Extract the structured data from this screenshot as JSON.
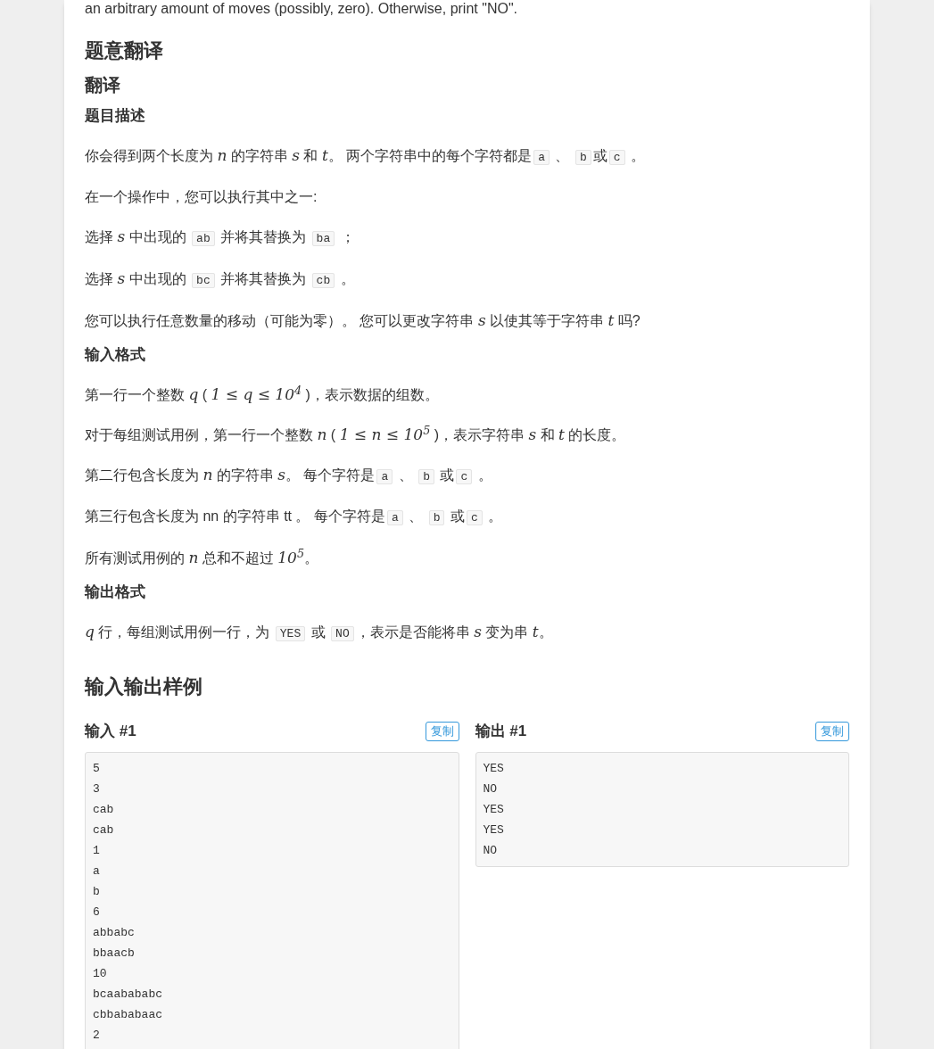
{
  "intro_tail": "an arbitrary amount of moves (possibly, zero). Otherwise, print \"NO\".",
  "translation": {
    "title": "题意翻译",
    "subtitle": "翻译",
    "sections": [
      {
        "heading": "题目描述",
        "paragraphs": [
          [
            {
              "kind": "text",
              "text": "你会得到两个长度为 "
            },
            {
              "kind": "math",
              "text": "n"
            },
            {
              "kind": "text",
              "text": " 的字符串 "
            },
            {
              "kind": "math",
              "text": "s"
            },
            {
              "kind": "text",
              "text": " 和 "
            },
            {
              "kind": "math",
              "text": "t"
            },
            {
              "kind": "text",
              "text": "。 两个字符串中的每个字符都是"
            },
            {
              "kind": "code",
              "text": "a"
            },
            {
              "kind": "text",
              "text": " 、 "
            },
            {
              "kind": "code",
              "text": "b"
            },
            {
              "kind": "text",
              "text": "或"
            },
            {
              "kind": "code",
              "text": "c"
            },
            {
              "kind": "text",
              "text": " 。"
            }
          ],
          [
            {
              "kind": "text",
              "text": "在一个操作中，您可以执行其中之一:"
            }
          ],
          [
            {
              "kind": "text",
              "text": "选择 "
            },
            {
              "kind": "math",
              "text": "s"
            },
            {
              "kind": "text",
              "text": " 中出现的 "
            },
            {
              "kind": "code",
              "text": "ab"
            },
            {
              "kind": "text",
              "text": " 并将其替换为 "
            },
            {
              "kind": "code",
              "text": "ba"
            },
            {
              "kind": "text",
              "text": " ；"
            }
          ],
          [
            {
              "kind": "text",
              "text": "选择 "
            },
            {
              "kind": "math",
              "text": "s"
            },
            {
              "kind": "text",
              "text": " 中出现的 "
            },
            {
              "kind": "code",
              "text": "bc"
            },
            {
              "kind": "text",
              "text": " 并将其替换为 "
            },
            {
              "kind": "code",
              "text": "cb"
            },
            {
              "kind": "text",
              "text": " 。"
            }
          ],
          [
            {
              "kind": "text",
              "text": "您可以执行任意数量的移动（可能为零）。 您可以更改字符串 "
            },
            {
              "kind": "math",
              "text": "s"
            },
            {
              "kind": "text",
              "text": " 以使其等于字符串 "
            },
            {
              "kind": "math",
              "text": "t"
            },
            {
              "kind": "text",
              "text": " 吗?"
            }
          ]
        ]
      },
      {
        "heading": "输入格式",
        "paragraphs": [
          [
            {
              "kind": "text",
              "text": "第一行一个整数 "
            },
            {
              "kind": "math",
              "text": "q"
            },
            {
              "kind": "text",
              "text": " ( "
            },
            {
              "kind": "math",
              "text": "1 ≤ q ≤ 10$^{4}$"
            },
            {
              "kind": "text",
              "text": " )，表示数据的组数。"
            }
          ],
          [
            {
              "kind": "text",
              "text": "对于每组测试用例，第一行一个整数 "
            },
            {
              "kind": "math",
              "text": "n"
            },
            {
              "kind": "text",
              "text": " ( "
            },
            {
              "kind": "math",
              "text": "1 ≤ n ≤ 10$^{5}$"
            },
            {
              "kind": "text",
              "text": " )，表示字符串 "
            },
            {
              "kind": "math",
              "text": "s"
            },
            {
              "kind": "text",
              "text": " 和 "
            },
            {
              "kind": "math",
              "text": "t"
            },
            {
              "kind": "text",
              "text": " 的长度。"
            }
          ],
          [
            {
              "kind": "text",
              "text": "第二行包含长度为 "
            },
            {
              "kind": "math",
              "text": "n"
            },
            {
              "kind": "text",
              "text": " 的字符串 "
            },
            {
              "kind": "math",
              "text": "s"
            },
            {
              "kind": "text",
              "text": "。 每个字符是"
            },
            {
              "kind": "code",
              "text": "a"
            },
            {
              "kind": "text",
              "text": " 、 "
            },
            {
              "kind": "code",
              "text": "b"
            },
            {
              "kind": "text",
              "text": " 或"
            },
            {
              "kind": "code",
              "text": "c"
            },
            {
              "kind": "text",
              "text": " 。"
            }
          ],
          [
            {
              "kind": "text",
              "text": "第三行包含长度为 nn 的字符串 tt 。 每个字符是"
            },
            {
              "kind": "code",
              "text": "a"
            },
            {
              "kind": "text",
              "text": " 、 "
            },
            {
              "kind": "code",
              "text": "b"
            },
            {
              "kind": "text",
              "text": " 或"
            },
            {
              "kind": "code",
              "text": "c"
            },
            {
              "kind": "text",
              "text": " 。"
            }
          ],
          [
            {
              "kind": "text",
              "text": "所有测试用例的 "
            },
            {
              "kind": "math",
              "text": "n"
            },
            {
              "kind": "text",
              "text": " 总和不超过 "
            },
            {
              "kind": "math",
              "text": "10$^{5}$"
            },
            {
              "kind": "text",
              "text": "。"
            }
          ]
        ]
      },
      {
        "heading": "输出格式",
        "paragraphs": [
          [
            {
              "kind": "math",
              "text": "q"
            },
            {
              "kind": "text",
              "text": " 行，每组测试用例一行，为 "
            },
            {
              "kind": "code",
              "text": "YES"
            },
            {
              "kind": "text",
              "text": " 或 "
            },
            {
              "kind": "code",
              "text": "NO"
            },
            {
              "kind": "text",
              "text": "，表示是否能将串 "
            },
            {
              "kind": "math",
              "text": "s"
            },
            {
              "kind": "text",
              "text": " 变为串 "
            },
            {
              "kind": "math",
              "text": "t"
            },
            {
              "kind": "text",
              "text": "。"
            }
          ]
        ]
      }
    ]
  },
  "samples": {
    "title": "输入输出样例",
    "blocks": [
      {
        "label": "输入 #1",
        "copy_button": "复制",
        "lines": [
          "5",
          "3",
          "cab",
          "cab",
          "1",
          "a",
          "b",
          "6",
          "abbabc",
          "bbaacb",
          "10",
          "bcaabababc",
          "cbbababaac",
          "2"
        ]
      },
      {
        "label": "输出 #1",
        "copy_button": "复制",
        "lines": [
          "YES",
          "NO",
          "YES",
          "YES",
          "NO"
        ]
      }
    ]
  }
}
